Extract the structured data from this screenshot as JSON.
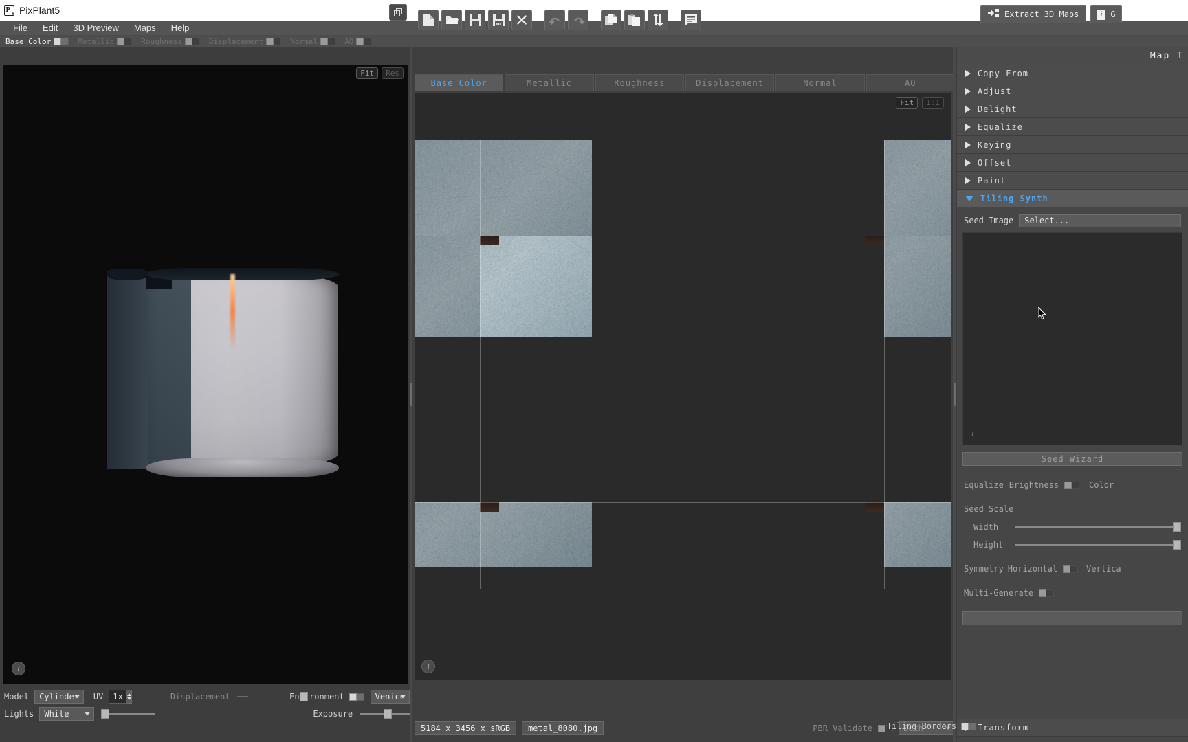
{
  "app": {
    "title": "PixPlant5",
    "logo_icon": "pixplant-logo-icon"
  },
  "menu": {
    "items": [
      "File",
      "Edit",
      "3D Preview",
      "Maps",
      "Help"
    ]
  },
  "channels": [
    {
      "label": "Base Color",
      "enabled": true
    },
    {
      "label": "Metallic",
      "enabled": false
    },
    {
      "label": "Roughness",
      "enabled": false
    },
    {
      "label": "Displacement",
      "enabled": false
    },
    {
      "label": "Normal",
      "enabled": false
    },
    {
      "label": "AO",
      "enabled": false
    }
  ],
  "toolbar": {
    "detach_icon": "detach-window-icon",
    "buttons": [
      {
        "icon": "new-file-icon",
        "name": "new-button",
        "enabled": true
      },
      {
        "icon": "open-folder-icon",
        "name": "open-button",
        "enabled": true
      },
      {
        "icon": "save-icon",
        "name": "save-button",
        "enabled": true
      },
      {
        "icon": "save-as-icon",
        "name": "save-as-button",
        "enabled": true
      },
      {
        "icon": "close-x-icon",
        "name": "close-button",
        "enabled": true
      },
      {
        "icon": "undo-arrow-icon",
        "name": "undo-button",
        "enabled": false
      },
      {
        "icon": "redo-arrow-icon",
        "name": "redo-button",
        "enabled": false
      },
      {
        "icon": "copy-icon",
        "name": "copy-button",
        "enabled": true
      },
      {
        "icon": "paste-icon",
        "name": "paste-button",
        "enabled": true
      },
      {
        "icon": "swap-updown-icon",
        "name": "swap-button",
        "enabled": true
      },
      {
        "icon": "comment-icon",
        "name": "notes-button",
        "enabled": true
      }
    ],
    "extract": {
      "label": "Extract 3D Maps",
      "icon": "extract-maps-icon"
    },
    "info": {
      "label": "G",
      "icon": "info-icon"
    }
  },
  "preview3d": {
    "fit_label": "Fit",
    "res_label": "Res",
    "info_glyph": "i",
    "model_label": "Model",
    "model_value": "Cylinder",
    "uv_label": "UV",
    "uv_value": "1x",
    "lights_label": "Lights",
    "lights_value": "White",
    "displacement_label": "Displacement",
    "environment_label": "Environment",
    "environment_value": "Venice",
    "exposure_label": "Exposure"
  },
  "editor": {
    "tabs": [
      {
        "label": "Base Color",
        "active": true
      },
      {
        "label": "Metallic",
        "active": false
      },
      {
        "label": "Roughness",
        "active": false
      },
      {
        "label": "Displacement",
        "active": false
      },
      {
        "label": "Normal",
        "active": false
      },
      {
        "label": "AO",
        "active": false
      }
    ],
    "fit_label": "Fit",
    "one_to_one_label": "1:1",
    "info_glyph": "i",
    "image_size": "5184 x 3456 x sRGB",
    "file_name": "metal_8080.jpg",
    "pbr_validate_label": "PBR Validate",
    "pbr_mode_value": "Both",
    "tiling_borders_label": "Tiling Borders"
  },
  "rightPanel": {
    "header": "Map T",
    "sections": [
      {
        "label": "Copy From",
        "open": false
      },
      {
        "label": "Adjust",
        "open": false
      },
      {
        "label": "Delight",
        "open": false
      },
      {
        "label": "Equalize",
        "open": false
      },
      {
        "label": "Keying",
        "open": false
      },
      {
        "label": "Offset",
        "open": false
      },
      {
        "label": "Paint",
        "open": false
      },
      {
        "label": "Tiling Synth",
        "open": true
      }
    ],
    "seed_image_label": "Seed Image",
    "seed_select_label": "Select...",
    "seed_well_glyph": "i",
    "seed_wizard_label": "Seed Wizard",
    "equalize_label": "Equalize",
    "brightness_label": "Brightness",
    "color_label": "Color",
    "seed_scale_label": "Seed Scale",
    "width_label": "Width",
    "height_label": "Height",
    "symmetry_label": "Symmetry",
    "horizontal_label": "Horizontal",
    "vertical_label": "Vertica",
    "multi_generate_label": "Multi-Generate",
    "transform_label": "Transform"
  },
  "colors": {
    "accent": "#4ea6f0",
    "panel": "#464646",
    "toolbar": "#4e4e4e",
    "viewport": "#0b0b0b",
    "canvas": "#2a2a2a",
    "titlebar": "#ffffff"
  }
}
